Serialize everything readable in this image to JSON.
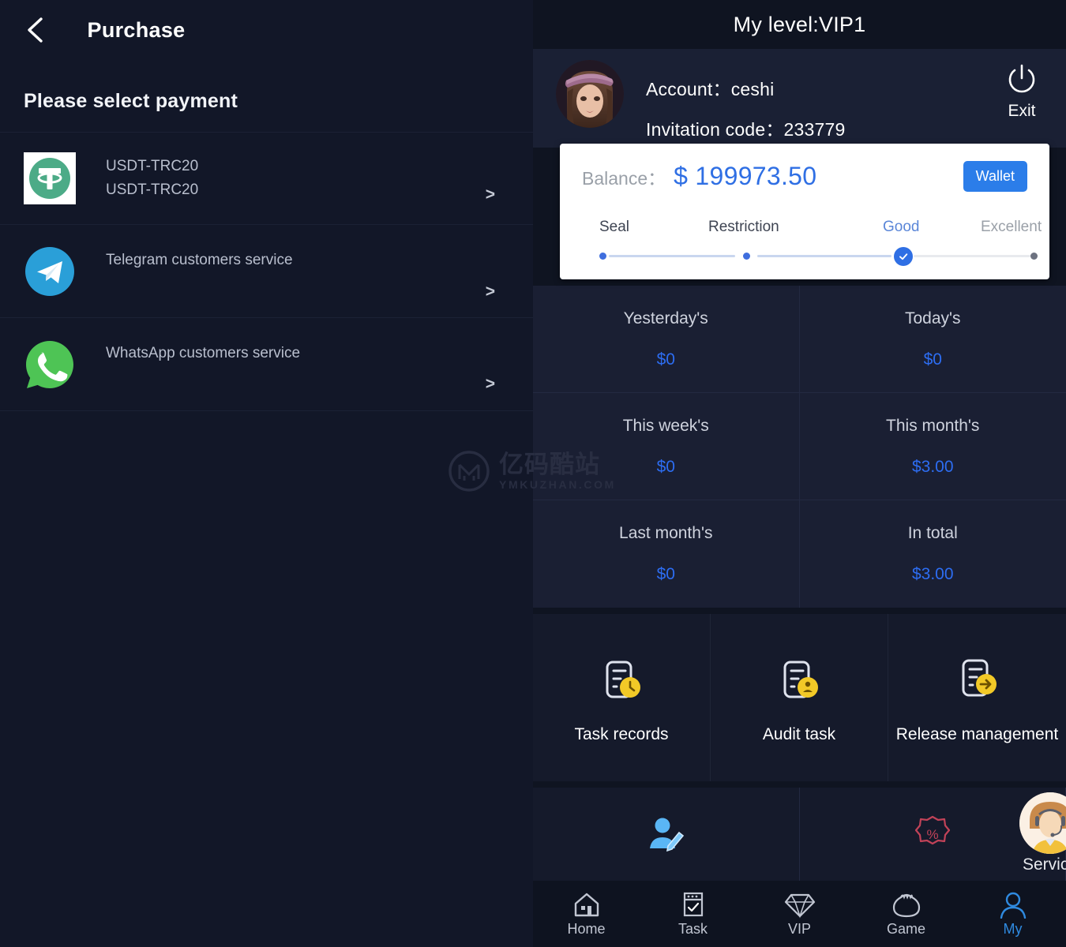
{
  "left": {
    "header_title": "Purchase",
    "back_icon": "back-chevron-icon",
    "section_title": "Please select payment",
    "payment_methods": [
      {
        "icon": "usdt-tether-icon",
        "line1": "USDT-TRC20",
        "line2": "USDT-TRC20",
        "chevron": ">"
      },
      {
        "icon": "telegram-icon",
        "line1": "Telegram customers service",
        "line2": "",
        "chevron": ">"
      },
      {
        "icon": "whatsapp-icon",
        "line1": "WhatsApp customers service",
        "line2": "",
        "chevron": ">"
      }
    ]
  },
  "right": {
    "header_title": "My level:VIP1",
    "account": {
      "avatar": "user-avatar",
      "account_line": "Account：ceshi",
      "invitation_line": "Invitation code：233779",
      "exit_label": "Exit",
      "exit_icon": "power-icon"
    },
    "balance": {
      "label": "Balance：",
      "amount": "$ 199973.50",
      "wallet_label": "Wallet",
      "levels": [
        "Seal",
        "Restriction",
        "Good",
        "Excellent"
      ],
      "active_level": "Good"
    },
    "stats": [
      {
        "title": "Yesterday's",
        "value": "$0"
      },
      {
        "title": "Today's",
        "value": "$0"
      },
      {
        "title": "This week's",
        "value": "$0"
      },
      {
        "title": "This month's",
        "value": "$3.00"
      },
      {
        "title": "Last month's",
        "value": "$0"
      },
      {
        "title": "In total",
        "value": "$3.00"
      }
    ],
    "tasks": [
      {
        "icon": "task-records-icon",
        "label": "Task records"
      },
      {
        "icon": "audit-task-icon",
        "label": "Audit task"
      },
      {
        "icon": "release-management-icon",
        "label": "Release management"
      }
    ],
    "quick": [
      {
        "icon": "edit-profile-icon"
      },
      {
        "icon": "discount-percent-icon"
      }
    ],
    "service": {
      "label": "Service",
      "icon": "service-agent-avatar"
    },
    "nav": [
      {
        "icon": "home-icon",
        "label": "Home",
        "active": false
      },
      {
        "icon": "task-checklist-icon",
        "label": "Task",
        "active": false
      },
      {
        "icon": "diamond-icon",
        "label": "VIP",
        "active": false
      },
      {
        "icon": "game-bag-icon",
        "label": "Game",
        "active": false
      },
      {
        "icon": "person-icon",
        "label": "My",
        "active": true
      }
    ]
  },
  "watermark": {
    "cn": "亿码酷站",
    "en": "YMKUZHAN.COM"
  },
  "colors": {
    "accent_blue": "#2d6df2",
    "wallet_blue": "#2b7de9",
    "left_bg": "#121728",
    "right_bg": "#0f1421",
    "card_bg": "#1a1f33"
  }
}
